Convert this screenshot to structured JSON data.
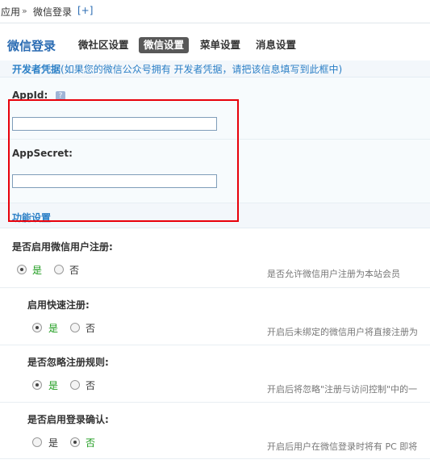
{
  "breadcrumb": {
    "root": "应用",
    "separator": "»",
    "current": "微信登录",
    "add": "[+]"
  },
  "header": {
    "app_title": "微信登录",
    "tabs": [
      {
        "label": "微社区设置",
        "active": false
      },
      {
        "label": "微信设置",
        "active": true
      },
      {
        "label": "菜单设置",
        "active": false
      },
      {
        "label": "消息设置",
        "active": false
      }
    ]
  },
  "dev_section": {
    "title": "开发者凭据",
    "note": "(如果您的微信公众号拥有 开发者凭据，请把该信息填写到此框中)"
  },
  "fields": {
    "appid": {
      "label": "AppId:",
      "help": "?",
      "value": ""
    },
    "appsecret": {
      "label": "AppSecret:",
      "value": ""
    }
  },
  "func_section": {
    "title": "功能设置"
  },
  "options": [
    {
      "label": "是否启用微信用户注册:",
      "yes": "是",
      "no": "否",
      "selected": "yes",
      "hint": "是否允许微信用户注册为本站会员"
    },
    {
      "label": "启用快速注册:",
      "yes": "是",
      "no": "否",
      "selected": "yes",
      "hint": "开启后未绑定的微信用户将直接注册为"
    },
    {
      "label": "是否忽略注册规则:",
      "yes": "是",
      "no": "否",
      "selected": "yes",
      "hint": "开启后将忽略\"注册与访问控制\"中的一"
    },
    {
      "label": "是否启用登录确认:",
      "yes": "是",
      "no": "否",
      "selected": "no",
      "hint": "开启后用户在微信登录时将有 PC 即将"
    }
  ],
  "colors": {
    "accent": "#2b6cb3",
    "highlight_border": "#e8000a",
    "active_tab_bg": "#585858",
    "option_on": "#1a9a1a"
  }
}
